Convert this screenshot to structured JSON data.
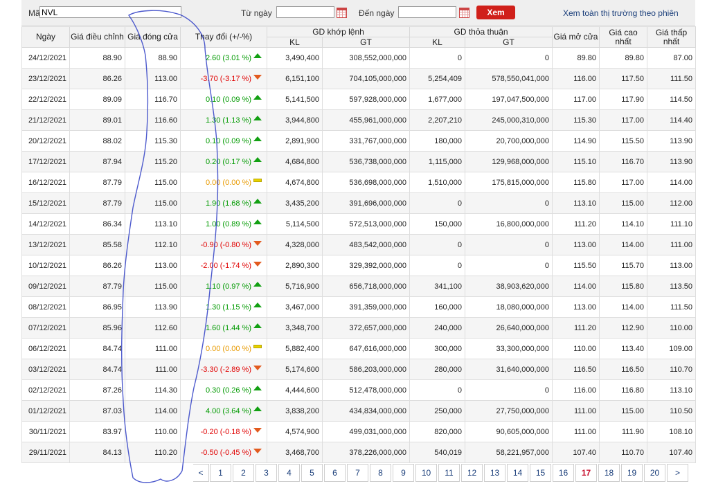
{
  "filter": {
    "symbol_label": "Mã",
    "symbol_value": "NVL",
    "from_label": "Từ ngày",
    "from_value": "",
    "to_label": "Đến ngày",
    "to_value": "",
    "submit_label": "Xem",
    "view_all_label": "Xem toàn thị trường theo phiên"
  },
  "table": {
    "headers": {
      "date": "Ngày",
      "adj_price": "Giá điều chỉnh",
      "close_price": "Giá đóng cửa",
      "change": "Thay đổi (+/-%)",
      "matched": "GD khớp lệnh",
      "negotiated": "GD thỏa thuận",
      "kl": "KL",
      "gt": "GT",
      "open": "Giá mở cửa",
      "high": "Giá cao nhất",
      "low": "Giá thấp nhất"
    },
    "rows": [
      {
        "date": "24/12/2021",
        "adj": "88.90",
        "close": "88.90",
        "chg": "2.60 (3.01 %)",
        "dir": "up",
        "mkl": "3,490,400",
        "mgt": "308,552,000,000",
        "nkl": "0",
        "ngt": "0",
        "open": "89.80",
        "high": "89.80",
        "low": "87.00"
      },
      {
        "date": "23/12/2021",
        "adj": "86.26",
        "close": "113.00",
        "chg": "-3.70 (-3.17 %)",
        "dir": "down",
        "mkl": "6,151,100",
        "mgt": "704,105,000,000",
        "nkl": "5,254,409",
        "ngt": "578,550,041,000",
        "open": "116.00",
        "high": "117.50",
        "low": "111.50"
      },
      {
        "date": "22/12/2021",
        "adj": "89.09",
        "close": "116.70",
        "chg": "0.10 (0.09 %)",
        "dir": "up",
        "mkl": "5,141,500",
        "mgt": "597,928,000,000",
        "nkl": "1,677,000",
        "ngt": "197,047,500,000",
        "open": "117.00",
        "high": "117.90",
        "low": "114.50"
      },
      {
        "date": "21/12/2021",
        "adj": "89.01",
        "close": "116.60",
        "chg": "1.30 (1.13 %)",
        "dir": "up",
        "mkl": "3,944,800",
        "mgt": "455,961,000,000",
        "nkl": "2,207,210",
        "ngt": "245,000,310,000",
        "open": "115.30",
        "high": "117.00",
        "low": "114.40"
      },
      {
        "date": "20/12/2021",
        "adj": "88.02",
        "close": "115.30",
        "chg": "0.10 (0.09 %)",
        "dir": "up",
        "mkl": "2,891,900",
        "mgt": "331,767,000,000",
        "nkl": "180,000",
        "ngt": "20,700,000,000",
        "open": "114.90",
        "high": "115.50",
        "low": "113.90"
      },
      {
        "date": "17/12/2021",
        "adj": "87.94",
        "close": "115.20",
        "chg": "0.20 (0.17 %)",
        "dir": "up",
        "mkl": "4,684,800",
        "mgt": "536,738,000,000",
        "nkl": "1,115,000",
        "ngt": "129,968,000,000",
        "open": "115.10",
        "high": "116.70",
        "low": "113.90"
      },
      {
        "date": "16/12/2021",
        "adj": "87.79",
        "close": "115.00",
        "chg": "0.00 (0.00 %)",
        "dir": "flat",
        "mkl": "4,674,800",
        "mgt": "536,698,000,000",
        "nkl": "1,510,000",
        "ngt": "175,815,000,000",
        "open": "115.80",
        "high": "117.00",
        "low": "114.00"
      },
      {
        "date": "15/12/2021",
        "adj": "87.79",
        "close": "115.00",
        "chg": "1.90 (1.68 %)",
        "dir": "up",
        "mkl": "3,435,200",
        "mgt": "391,696,000,000",
        "nkl": "0",
        "ngt": "0",
        "open": "113.10",
        "high": "115.00",
        "low": "112.00"
      },
      {
        "date": "14/12/2021",
        "adj": "86.34",
        "close": "113.10",
        "chg": "1.00 (0.89 %)",
        "dir": "up",
        "mkl": "5,114,500",
        "mgt": "572,513,000,000",
        "nkl": "150,000",
        "ngt": "16,800,000,000",
        "open": "111.20",
        "high": "114.10",
        "low": "111.10"
      },
      {
        "date": "13/12/2021",
        "adj": "85.58",
        "close": "112.10",
        "chg": "-0.90 (-0.80 %)",
        "dir": "down",
        "mkl": "4,328,000",
        "mgt": "483,542,000,000",
        "nkl": "0",
        "ngt": "0",
        "open": "113.00",
        "high": "114.00",
        "low": "111.00"
      },
      {
        "date": "10/12/2021",
        "adj": "86.26",
        "close": "113.00",
        "chg": "-2.00 (-1.74 %)",
        "dir": "down",
        "mkl": "2,890,300",
        "mgt": "329,392,000,000",
        "nkl": "0",
        "ngt": "0",
        "open": "115.50",
        "high": "115.70",
        "low": "113.00"
      },
      {
        "date": "09/12/2021",
        "adj": "87.79",
        "close": "115.00",
        "chg": "1.10 (0.97 %)",
        "dir": "up",
        "mkl": "5,716,900",
        "mgt": "656,718,000,000",
        "nkl": "341,100",
        "ngt": "38,903,620,000",
        "open": "114.00",
        "high": "115.80",
        "low": "113.50"
      },
      {
        "date": "08/12/2021",
        "adj": "86.95",
        "close": "113.90",
        "chg": "1.30 (1.15 %)",
        "dir": "up",
        "mkl": "3,467,000",
        "mgt": "391,359,000,000",
        "nkl": "160,000",
        "ngt": "18,080,000,000",
        "open": "113.00",
        "high": "114.00",
        "low": "111.50"
      },
      {
        "date": "07/12/2021",
        "adj": "85.96",
        "close": "112.60",
        "chg": "1.60 (1.44 %)",
        "dir": "up",
        "mkl": "3,348,700",
        "mgt": "372,657,000,000",
        "nkl": "240,000",
        "ngt": "26,640,000,000",
        "open": "111.20",
        "high": "112.90",
        "low": "110.00"
      },
      {
        "date": "06/12/2021",
        "adj": "84.74",
        "close": "111.00",
        "chg": "0.00 (0.00 %)",
        "dir": "flat",
        "mkl": "5,882,400",
        "mgt": "647,616,000,000",
        "nkl": "300,000",
        "ngt": "33,300,000,000",
        "open": "110.00",
        "high": "113.40",
        "low": "109.00"
      },
      {
        "date": "03/12/2021",
        "adj": "84.74",
        "close": "111.00",
        "chg": "-3.30 (-2.89 %)",
        "dir": "down",
        "mkl": "5,174,600",
        "mgt": "586,203,000,000",
        "nkl": "280,000",
        "ngt": "31,640,000,000",
        "open": "116.50",
        "high": "116.50",
        "low": "110.70"
      },
      {
        "date": "02/12/2021",
        "adj": "87.26",
        "close": "114.30",
        "chg": "0.30 (0.26 %)",
        "dir": "up",
        "mkl": "4,444,600",
        "mgt": "512,478,000,000",
        "nkl": "0",
        "ngt": "0",
        "open": "116.00",
        "high": "116.80",
        "low": "113.10"
      },
      {
        "date": "01/12/2021",
        "adj": "87.03",
        "close": "114.00",
        "chg": "4.00 (3.64 %)",
        "dir": "up",
        "mkl": "3,838,200",
        "mgt": "434,834,000,000",
        "nkl": "250,000",
        "ngt": "27,750,000,000",
        "open": "111.00",
        "high": "115.00",
        "low": "110.50"
      },
      {
        "date": "30/11/2021",
        "adj": "83.97",
        "close": "110.00",
        "chg": "-0.20 (-0.18 %)",
        "dir": "down",
        "mkl": "4,574,900",
        "mgt": "499,031,000,000",
        "nkl": "820,000",
        "ngt": "90,605,000,000",
        "open": "111.00",
        "high": "111.90",
        "low": "108.10"
      },
      {
        "date": "29/11/2021",
        "adj": "84.13",
        "close": "110.20",
        "chg": "-0.50 (-0.45 %)",
        "dir": "down",
        "mkl": "3,468,700",
        "mgt": "378,226,000,000",
        "nkl": "540,019",
        "ngt": "58,221,957,000",
        "open": "107.40",
        "high": "110.70",
        "low": "107.40"
      }
    ]
  },
  "pagination": {
    "prev": "<",
    "next": ">",
    "pages": [
      "1",
      "2",
      "3",
      "4",
      "5",
      "6",
      "7",
      "8",
      "9",
      "10",
      "11",
      "12",
      "13",
      "14",
      "15",
      "16",
      "17",
      "18",
      "19",
      "20"
    ],
    "current": "17"
  },
  "colors": {
    "up": "#009a00",
    "down": "#e00000",
    "flat": "#e89a00",
    "button": "#d0201a",
    "scribble": "#3a48c8"
  }
}
